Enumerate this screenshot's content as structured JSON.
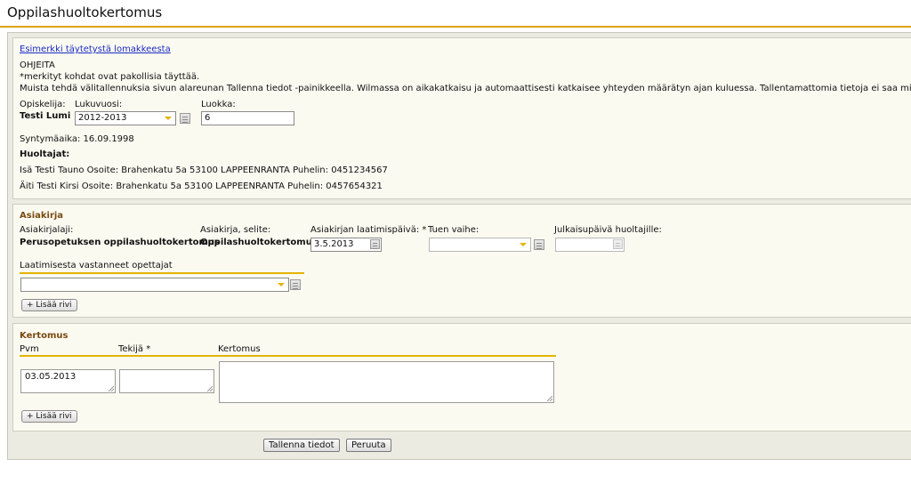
{
  "page": {
    "title": "Oppilashuoltokertomus"
  },
  "info": {
    "example_link": "Esimerkki täytetystä lomakkeesta",
    "instructions_heading": "OHJEITA",
    "instruction_required": "*merkityt kohdat ovat pakollisia täyttää.",
    "instruction_save": "Muista tehdä välitallennuksia sivun alareunan Tallenna tiedot -painikkeella. Wilmassa on aikakatkaisu ja automaattisesti katkaisee yhteyden määrätyn ajan kuluessa. Tallentamattomia tietoja ei saa mistään.",
    "student_label": "Opiskelija:",
    "student_name": "Testi Lumi",
    "year_label": "Lukuvuosi:",
    "year_value": "2012-2013",
    "class_label": "Luokka:",
    "class_value": "6",
    "birthdate": "Syntymäaika: 16.09.1998",
    "guardians_heading": "Huoltajat:",
    "guardian_1": "Isä Testi Tauno Osoite: Brahenkatu 5a 53100 LAPPEENRANTA Puhelin: 0451234567",
    "guardian_2": "Äiti Testi Kirsi Osoite: Brahenkatu 5a 53100 LAPPEENRANTA Puhelin: 0457654321"
  },
  "document": {
    "heading": "Asiakirja",
    "type_label": "Asiakirjalaji:",
    "type_value": "Perusopetuksen oppilashuoltokertomus",
    "desc_label": "Asiakirja, selite:",
    "desc_value": "Oppilashuoltokertomus",
    "created_label": "Asiakirjan laatimispäivä: *",
    "created_value": "3.5.2013",
    "support_label": "Tuen vaihe:",
    "support_value": "",
    "publish_label": "Julkaisupäivä huoltajille:",
    "publish_value": "",
    "teachers_label": "Laatimisesta vastanneet opettajat",
    "teachers_value": "",
    "add_row": "+ Lisää rivi"
  },
  "report": {
    "heading": "Kertomus",
    "col_date": "Pvm",
    "col_author": "Tekijä *",
    "col_report": "Kertomus",
    "date_value": "03.05.2013",
    "author_value": "",
    "report_value": "",
    "add_row": "+ Lisää rivi"
  },
  "actions": {
    "save": "Tallenna tiedot",
    "cancel": "Peruuta"
  },
  "colors": {
    "accent": "#e2b400",
    "section_heading": "#7a4a10",
    "link": "#1a2bc2",
    "panel_bg": "#fbfaf1",
    "outer_bg": "#ecebe2"
  }
}
